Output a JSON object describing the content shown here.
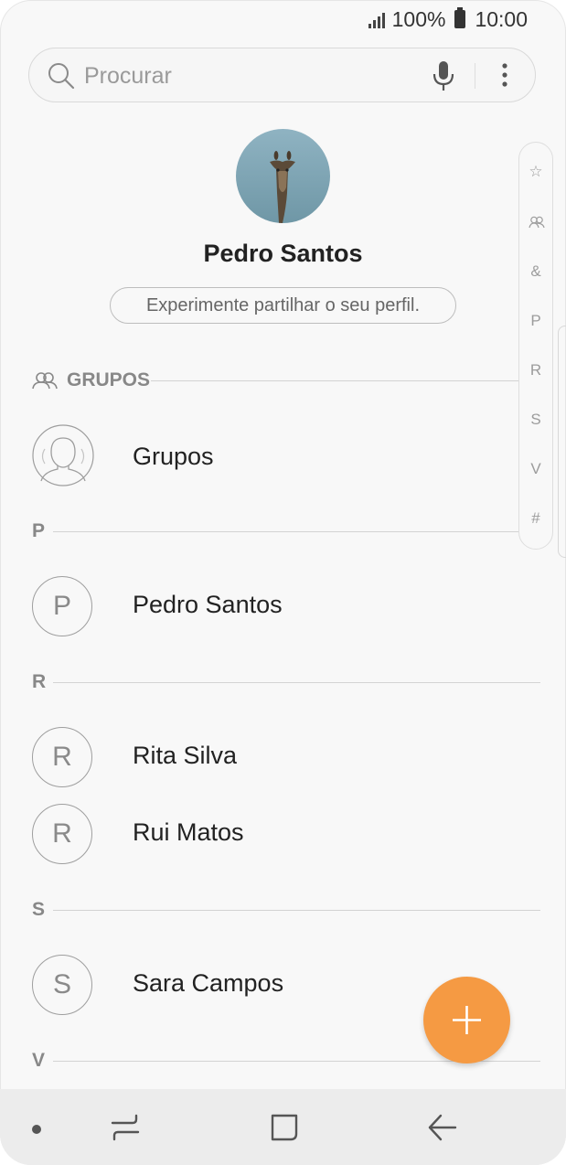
{
  "status_bar": {
    "battery": "100%",
    "time": "10:00"
  },
  "search": {
    "placeholder": "Procurar"
  },
  "profile": {
    "name": "Pedro Santos",
    "share_label": "Experimente partilhar o seu perfil."
  },
  "sections": {
    "groups": {
      "label": "GRUPOS"
    },
    "p": {
      "label": "P"
    },
    "r": {
      "label": "R"
    },
    "s": {
      "label": "S"
    },
    "v": {
      "label": "V"
    }
  },
  "groups_item": {
    "name": "Grupos"
  },
  "contacts": [
    {
      "initial": "P",
      "name": "Pedro Santos"
    },
    {
      "initial": "R",
      "name": "Rita Silva"
    },
    {
      "initial": "R",
      "name": "Rui Matos"
    },
    {
      "initial": "S",
      "name": "Sara Campos"
    }
  ],
  "index_bar": [
    "☆",
    "groups-icon",
    "&",
    "P",
    "R",
    "S",
    "V",
    "#"
  ],
  "fab": {
    "icon": "plus-icon",
    "color": "#f59a43"
  },
  "nav": {
    "items": [
      "dot",
      "recent-apps-icon",
      "home-icon",
      "back-icon"
    ]
  }
}
